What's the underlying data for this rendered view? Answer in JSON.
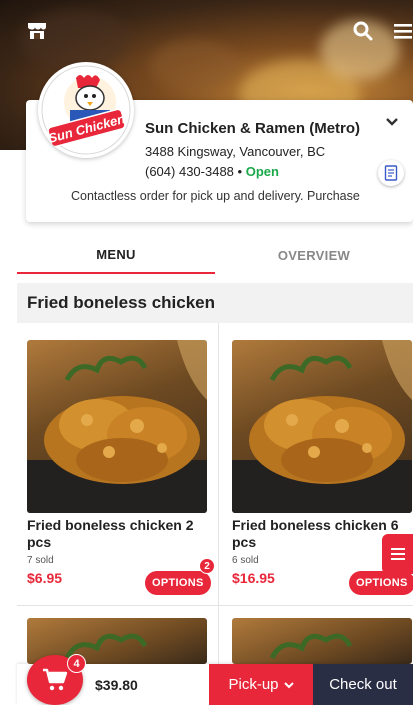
{
  "store": {
    "name": "Sun Chicken & Ramen (Metro)",
    "address": "3488 Kingsway, Vancouver, BC",
    "phone": "(604) 430-3488",
    "separator": "•",
    "status": "Open",
    "tagline": "Contactless order for pick up and delivery. Purchase",
    "logo_text": "Sun Chicken"
  },
  "tabs": [
    {
      "label": "MENU",
      "active": true
    },
    {
      "label": "OVERVIEW",
      "active": false
    }
  ],
  "category": {
    "title": "Fried boneless chicken"
  },
  "items": [
    {
      "name": "Fried boneless chicken 2 pcs",
      "sold": "7 sold",
      "price": "$6.95",
      "options_label": "OPTIONS",
      "badge": "2"
    },
    {
      "name": "Fried boneless chicken 6 pcs",
      "sold": "6 sold",
      "price": "$16.95",
      "options_label": "OPTIONS"
    }
  ],
  "cart": {
    "count": "4",
    "total": "$39.80"
  },
  "actions": {
    "pickup_label": "Pick-up",
    "checkout_label": "Check out"
  },
  "icons": {
    "store": "store-icon",
    "search": "search-icon",
    "menu": "hamburger-menu-icon",
    "chevron": "chevron-down-icon",
    "receipt": "receipt-icon",
    "cart": "cart-icon"
  },
  "colors": {
    "accent": "#e8283a",
    "open": "#1aa84a",
    "checkout": "#2a2e45"
  }
}
